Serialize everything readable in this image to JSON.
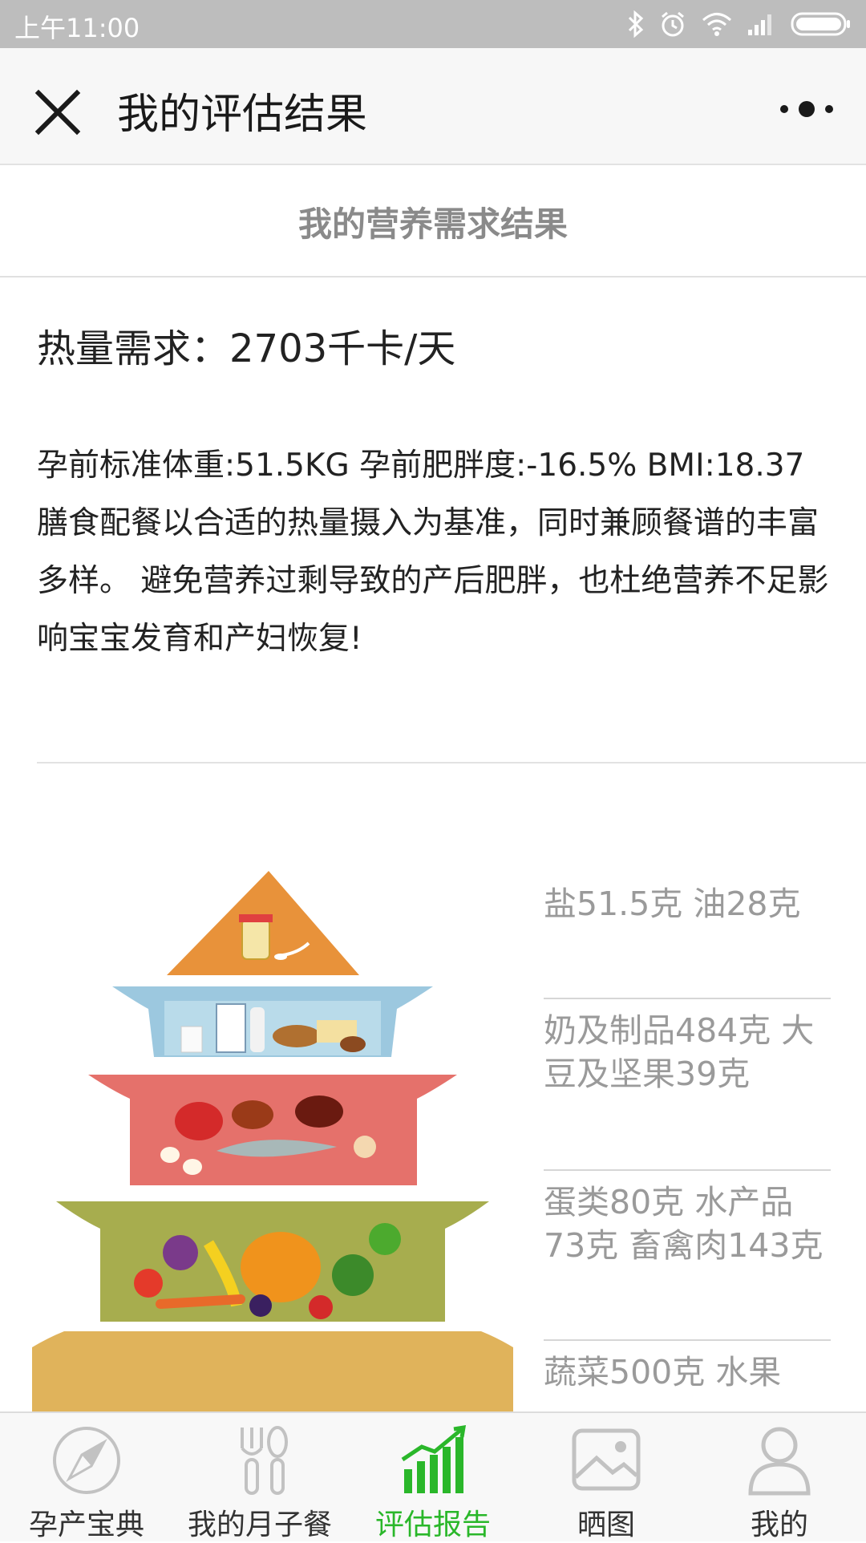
{
  "status_bar": {
    "time": "上午11:00"
  },
  "header": {
    "title": "我的评估结果"
  },
  "section": {
    "title": "我的营养需求结果"
  },
  "calorie": {
    "text": "热量需求：2703千卡/天"
  },
  "description": {
    "text": "孕前标准体重:51.5KG 孕前肥胖度:-16.5% BMI:18.37 膳食配餐以合适的热量摄入为基准，同时兼顾餐谱的丰富多样。 避免营养过剩导致的产后肥胖，也杜绝营养不足影响宝宝发育和产妇恢复!"
  },
  "pyramid_labels": [
    "盐51.5克 油28克",
    "奶及制品484克 大豆及坚果39克",
    "蛋类80克 水产品73克 畜禽肉143克",
    "蔬菜500克 水果"
  ],
  "tabs": [
    {
      "label": "孕产宝典",
      "icon": "compass-icon",
      "active": false
    },
    {
      "label": "我的月子餐",
      "icon": "cutlery-icon",
      "active": false
    },
    {
      "label": "评估报告",
      "icon": "bar-chart-icon",
      "active": true
    },
    {
      "label": "晒图",
      "icon": "picture-icon",
      "active": false
    },
    {
      "label": "我的",
      "icon": "person-icon",
      "active": false
    }
  ],
  "colors": {
    "active_tab": "#2ab72a",
    "pyramid_top": "#e8923a",
    "pyramid_tier2": "#9cc8df",
    "pyramid_tier3": "#e5716b",
    "pyramid_tier4": "#a7ad4e",
    "pyramid_base": "#e0b35b"
  }
}
